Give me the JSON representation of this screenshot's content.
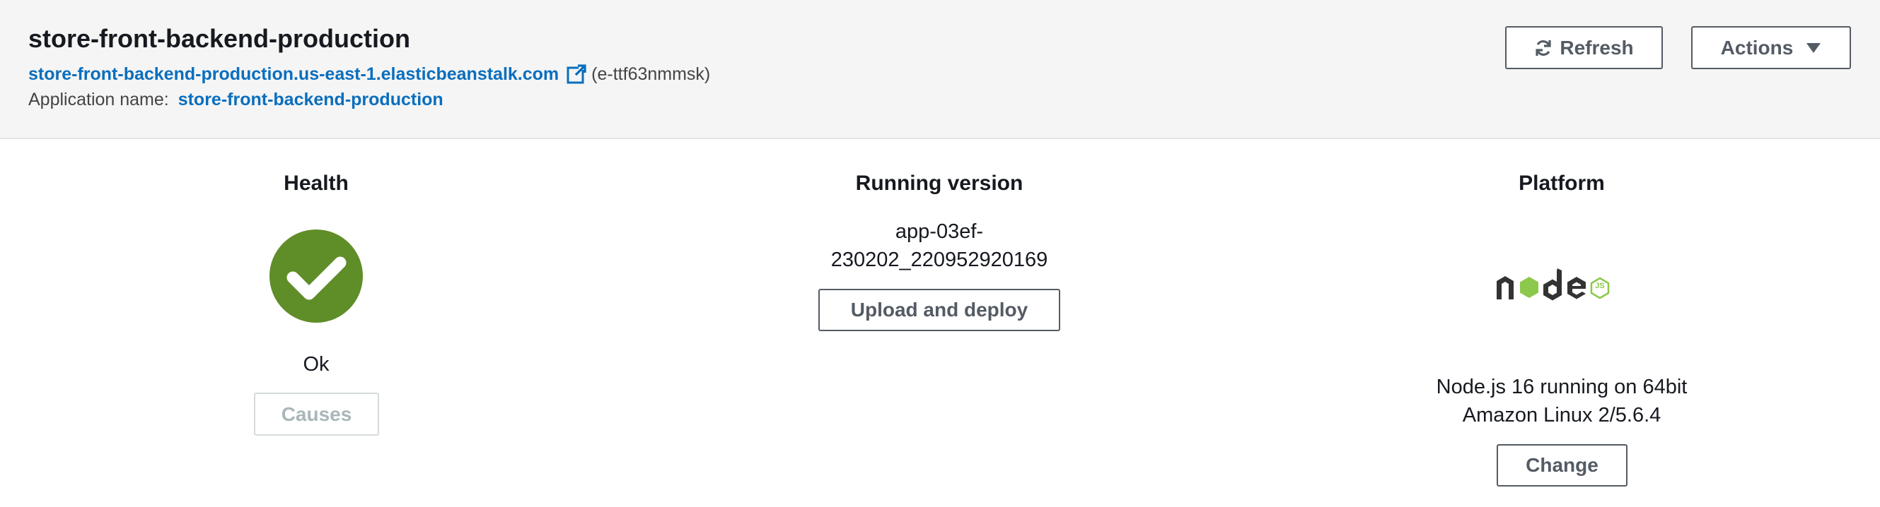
{
  "environment": {
    "title": "store-front-backend-production",
    "url": "store-front-backend-production.us-east-1.elasticbeanstalk.com",
    "env_id": "(e-ttf63nmmsk)",
    "application_label": "Application name:",
    "application_name": "store-front-backend-production"
  },
  "toolbar": {
    "refresh_label": "Refresh",
    "actions_label": "Actions"
  },
  "health": {
    "title": "Health",
    "status": "Ok",
    "causes_label": "Causes",
    "status_color": "#5f8d27"
  },
  "running_version": {
    "title": "Running version",
    "version_line1": "app-03ef-",
    "version_line2": "230202_220952920169",
    "upload_label": "Upload and deploy"
  },
  "platform": {
    "title": "Platform",
    "logo_text": "node",
    "logo_badge": "JS",
    "description_line1": "Node.js 16 running on 64bit",
    "description_line2": "Amazon Linux 2/5.6.4",
    "change_label": "Change"
  },
  "colors": {
    "link": "#0a6ebd",
    "node_dark": "#333333",
    "node_green": "#8cc84b"
  }
}
